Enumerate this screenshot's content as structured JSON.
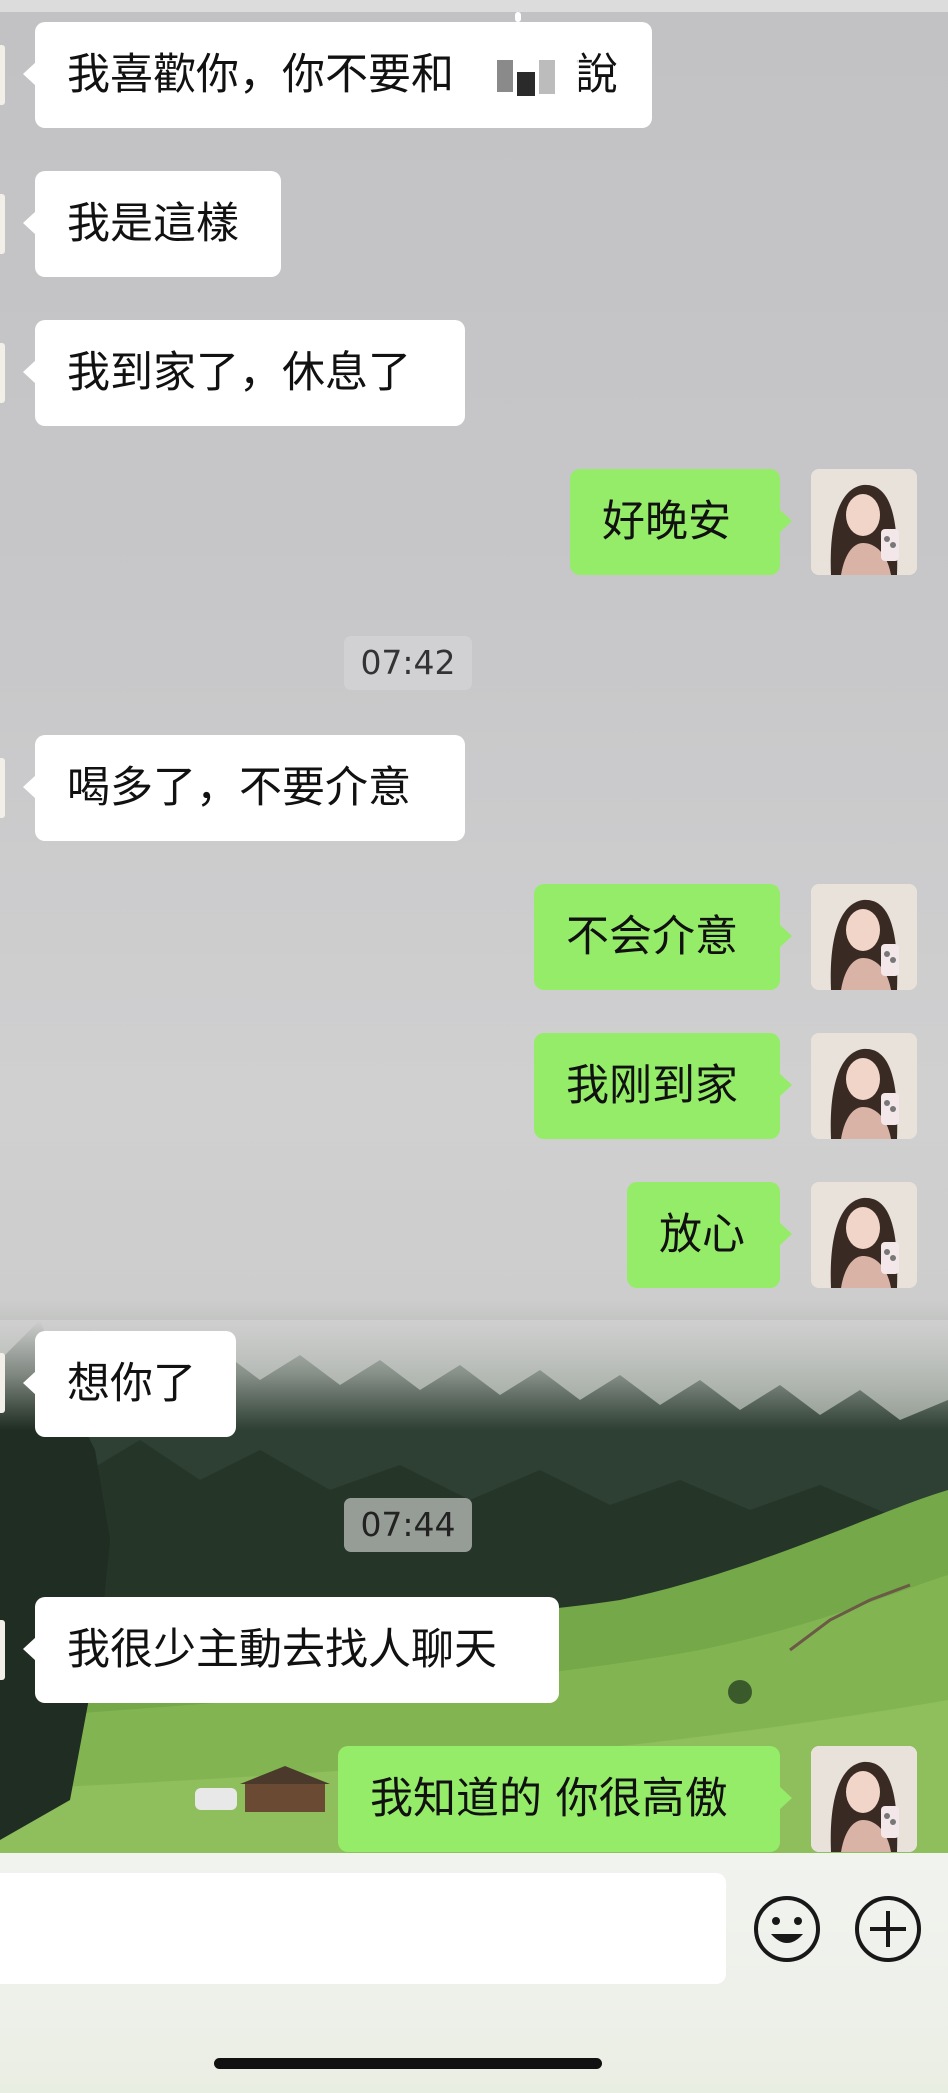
{
  "chat": {
    "messages": [
      {
        "side": "in",
        "text": "我喜歡你，你不要和"
      },
      {
        "side": "in",
        "text": "我是這樣"
      },
      {
        "side": "in",
        "text": "我到家了，休息了"
      },
      {
        "side": "out",
        "text": "好晚安"
      },
      {
        "side": "in",
        "text": "喝多了，不要介意"
      },
      {
        "side": "out",
        "text": "不会介意"
      },
      {
        "side": "out",
        "text": "我刚到家"
      },
      {
        "side": "out",
        "text": "放心"
      },
      {
        "side": "in",
        "text": "想你了"
      },
      {
        "side": "in",
        "text": "我很少主動去找人聊天"
      },
      {
        "side": "out",
        "text": "我知道的 你很高傲"
      }
    ],
    "first_message_tail": "說",
    "timestamps": [
      "07:42",
      "07:44"
    ]
  },
  "input_bar": {
    "emoji_icon": "smiley-icon",
    "plus_icon": "plus-circle-icon"
  },
  "colors": {
    "outgoing_bubble": "#95ec69",
    "incoming_bubble": "#ffffff"
  }
}
